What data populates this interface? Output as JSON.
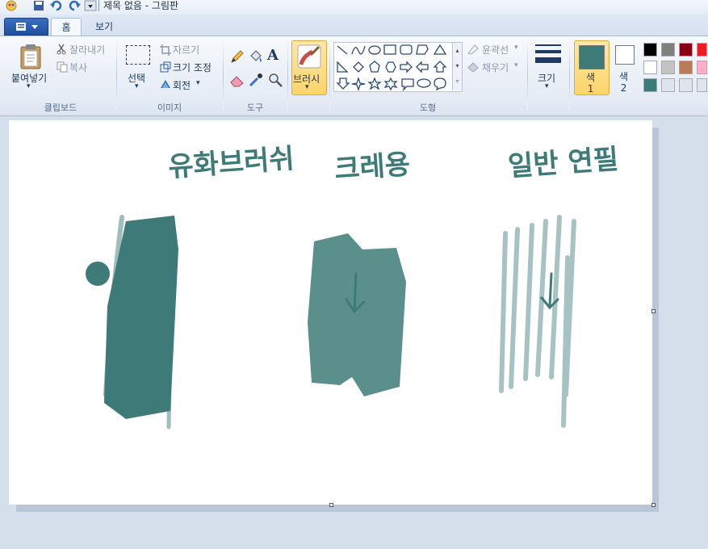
{
  "window": {
    "title": "제목 없음 - 그림판"
  },
  "tabs": [
    {
      "label": "홈",
      "active": true
    },
    {
      "label": "보기",
      "active": false
    }
  ],
  "clipboard": {
    "paste_label": "붙여넣기",
    "cut_label": "잘라내기",
    "copy_label": "복사",
    "group_label": "클립보드"
  },
  "image": {
    "select_label": "선택",
    "crop_label": "자르기",
    "resize_label": "크기 조정",
    "rotate_label": "회전",
    "group_label": "이미지"
  },
  "tools": {
    "group_label": "도구",
    "icons": [
      "pencil-icon",
      "fill-icon",
      "text-icon",
      "eraser-icon",
      "color-picker-icon",
      "magnifier-icon"
    ]
  },
  "brushes": {
    "label": "브러시"
  },
  "shapes": {
    "outline_label": "윤곽선",
    "fill_label": "채우기",
    "group_label": "도형"
  },
  "size": {
    "label": "크기"
  },
  "colors": {
    "color1_label": "색\n1",
    "color1_value": "#3e7b78",
    "color2_label": "색\n2",
    "color2_value": "#ffffff",
    "palette": [
      "#000000",
      "#7f7f7f",
      "#880015",
      "#ed1c24",
      "#ffffff",
      "#c3c3c3",
      "#b97a57",
      "#ffaec9",
      "#3e7b78",
      "#dfe5ec",
      "#dfe5ec",
      "#dfe5ec"
    ]
  },
  "canvas": {
    "ink_color": "#3e7b78",
    "captions": [
      "유화브러쉬",
      "크레용",
      "일반 연필"
    ]
  }
}
